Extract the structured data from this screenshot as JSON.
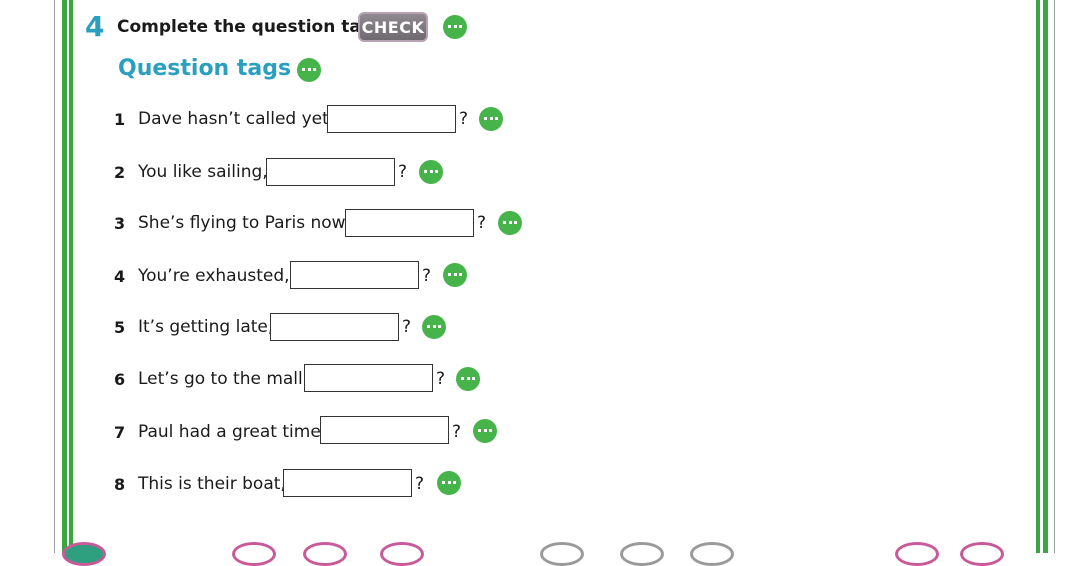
{
  "exercise": {
    "number": "4",
    "title": "Complete the question tags.",
    "check_label": "CHECK"
  },
  "section": {
    "title": "Question tags"
  },
  "items": [
    {
      "number": "1",
      "text": "Dave hasn’t called yet,",
      "value": "",
      "mark": "?"
    },
    {
      "number": "2",
      "text": "You like sailing,",
      "value": "",
      "mark": "?"
    },
    {
      "number": "3",
      "text": "She’s flying to Paris now,",
      "value": "",
      "mark": "?"
    },
    {
      "number": "4",
      "text": "You’re exhausted,",
      "value": "",
      "mark": "?"
    },
    {
      "number": "5",
      "text": "It’s getting late,",
      "value": "",
      "mark": "?"
    },
    {
      "number": "6",
      "text": "Let’s go to the mall,",
      "value": "",
      "mark": "?"
    },
    {
      "number": "7",
      "text": "Paul had a great time,",
      "value": "",
      "mark": "?"
    },
    {
      "number": "8",
      "text": "This is their boat,",
      "value": "",
      "mark": "?"
    }
  ],
  "icons": {
    "more": "more-options-icon"
  },
  "colors": {
    "accent": "#2a9fbf",
    "green": "#46b34b",
    "border_green": "#3aa63f",
    "check_bg": "#7d787e"
  }
}
